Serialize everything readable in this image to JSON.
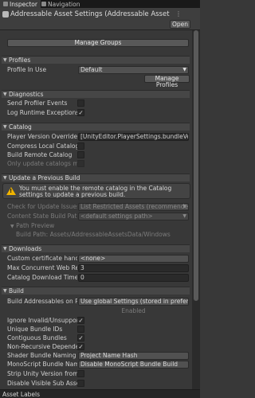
{
  "tabs": [
    {
      "label": "Inspector",
      "active": true
    },
    {
      "label": "Navigation",
      "active": false
    }
  ],
  "header": {
    "title": "Addressable Asset Settings (Addressable Asset Setti",
    "menu_glyph": "⋮",
    "open_label": "Open"
  },
  "manage_groups_label": "Manage Groups",
  "sections": {
    "profiles": "Profiles",
    "diagnostics": "Diagnostics",
    "catalog": "Catalog",
    "update": "Update a Previous Build",
    "downloads": "Downloads",
    "build": "Build"
  },
  "profiles": {
    "profile_label": "Profile In Use",
    "profile_value": "Default",
    "manage_label": "Manage Profiles"
  },
  "diagnostics": {
    "send_events_label": "Send Profiler Events",
    "send_events_checked": false,
    "log_exceptions_label": "Log Runtime Exceptions",
    "log_exceptions_checked": true
  },
  "catalog": {
    "version_label": "Player Version Override",
    "version_value": "[UnityEditor.PlayerSettings.bundleVersion]",
    "compress_label": "Compress Local Catalog",
    "compress_checked": false,
    "remote_label": "Build Remote Catalog",
    "remote_checked": false,
    "only_update_label": "Only update catalogs manu",
    "only_update_checked": false
  },
  "update": {
    "help_text": "You must enable the remote catalog in the Catalog settings to update a previous build.",
    "check_label": "Check for Update Issues",
    "check_value": "List Restricted Assets (recommended)",
    "state_label": "Content State Build Path",
    "state_value": "<default settings path>",
    "path_preview_label": "Path Preview",
    "path_preview_value": "Build Path: Assets/AddressableAssetsData/Windows"
  },
  "downloads": {
    "cert_label": "Custom certificate handler",
    "cert_value": "<none>",
    "max_label": "Max Concurrent Web Reque",
    "max_value": "3",
    "timeout_label": "Catalog Download Timeout",
    "timeout_value": "0"
  },
  "build": {
    "addressables_label": "Build Addressables on Playe",
    "addressables_value": "Use global Settings (stored in preferences",
    "enabled_label": "Enabled",
    "ignore_label": "Ignore Invalid/Unsupported",
    "ignore_checked": true,
    "unique_label": "Unique Bundle IDs",
    "unique_checked": false,
    "contiguous_label": "Contiguous Bundles",
    "contiguous_checked": true,
    "nonrecursive_label": "Non-Recursive Dependenc",
    "nonrecursive_checked": true,
    "shader_label": "Shader Bundle Naming Pref",
    "shader_value": "Project Name Hash",
    "mono_label": "MonoScript Bundle Naming",
    "mono_value": "Disable MonoScript Bundle Build",
    "strip_label": "Strip Unity Version from Ass",
    "strip_checked": false,
    "disable_label": "Disable Visible Sub Asset Re",
    "disable_checked": false
  },
  "bottom_label": "Asset Labels"
}
